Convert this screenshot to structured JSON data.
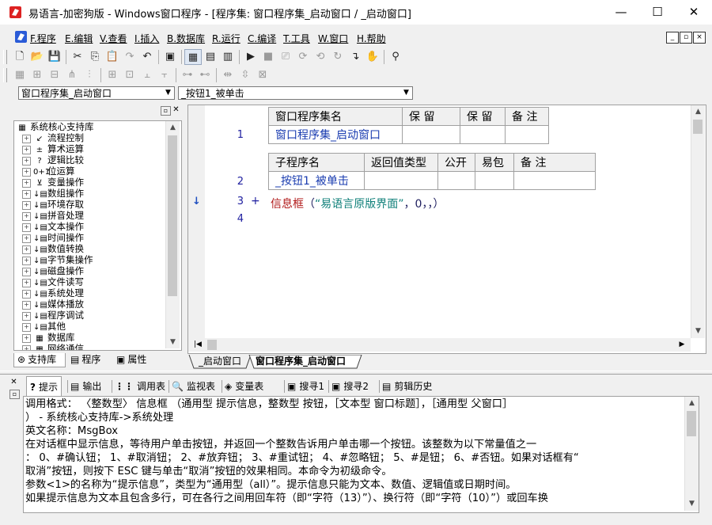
{
  "window": {
    "title": "易语言-加密狗版 - Windows窗口程序 - [程序集: 窗口程序集_启动窗口 / _启动窗口]",
    "minimize": "—",
    "maximize": "☐",
    "close": "✕"
  },
  "menu": {
    "items": [
      "F.程序",
      "E.编辑",
      "V.查看",
      "I.插入",
      "B.数据库",
      "R.运行",
      "C.编译",
      "T.工具",
      "W.窗口",
      "H.帮助"
    ],
    "mdi": [
      "_",
      "▫",
      "×"
    ]
  },
  "toolbar1": {
    "items": [
      {
        "name": "new-icon",
        "glyph": "🗋",
        "enabled": true
      },
      {
        "name": "open-icon",
        "glyph": "📂",
        "enabled": true
      },
      {
        "name": "save-icon",
        "glyph": "💾",
        "enabled": true
      },
      {
        "name": "sep",
        "glyph": "",
        "enabled": false
      },
      {
        "name": "cut-icon",
        "glyph": "✂",
        "enabled": true
      },
      {
        "name": "copy-icon",
        "glyph": "⎘",
        "enabled": true
      },
      {
        "name": "paste-icon",
        "glyph": "📋",
        "enabled": true
      },
      {
        "name": "redo-icon",
        "glyph": "↷",
        "enabled": false
      },
      {
        "name": "undo-icon",
        "glyph": "↶",
        "enabled": true
      },
      {
        "name": "sep",
        "glyph": "",
        "enabled": false
      },
      {
        "name": "find-icon",
        "glyph": "▣",
        "enabled": true
      },
      {
        "name": "sep",
        "glyph": "",
        "enabled": false
      },
      {
        "name": "layout-1-icon",
        "glyph": "▦",
        "enabled": true,
        "selected": true
      },
      {
        "name": "layout-2-icon",
        "glyph": "▤",
        "enabled": true
      },
      {
        "name": "layout-3-icon",
        "glyph": "▥",
        "enabled": true
      },
      {
        "name": "sep",
        "glyph": "",
        "enabled": false
      },
      {
        "name": "run-icon",
        "glyph": "▶",
        "enabled": true
      },
      {
        "name": "stop-icon",
        "glyph": "■",
        "enabled": false
      },
      {
        "name": "step-1-icon",
        "glyph": "⎚",
        "enabled": false
      },
      {
        "name": "step-2-icon",
        "glyph": "⟳",
        "enabled": false
      },
      {
        "name": "step-3-icon",
        "glyph": "⟲",
        "enabled": false
      },
      {
        "name": "step-4-icon",
        "glyph": "↻",
        "enabled": false
      },
      {
        "name": "step-into-icon",
        "glyph": "↴",
        "enabled": true
      },
      {
        "name": "hand-icon",
        "glyph": "✋",
        "enabled": true
      },
      {
        "name": "sep",
        "glyph": "",
        "enabled": false
      },
      {
        "name": "binoculars-icon",
        "glyph": "⚲",
        "enabled": true
      }
    ]
  },
  "toolbar2": {
    "items": [
      "▦",
      "⊞",
      "⊟",
      "⋔",
      "⫶",
      "⊞",
      "⊡",
      "⫠",
      "⫟",
      "⊶",
      "⊷",
      "⇹",
      "⇳",
      "⊠"
    ]
  },
  "selectors": {
    "class": "窗口程序集_启动窗口",
    "method": "_按钮1_被单击"
  },
  "tree": {
    "items": [
      {
        "label": "系统核心支持库",
        "icon": "▦",
        "root": true
      },
      {
        "label": "流程控制",
        "icon": "↙"
      },
      {
        "label": "算术运算",
        "icon": "±"
      },
      {
        "label": "逻辑比较",
        "icon": "?"
      },
      {
        "label": "位运算",
        "icon": "0+1"
      },
      {
        "label": "变量操作",
        "icon": "⊻"
      },
      {
        "label": "数组操作",
        "icon": "↓▤"
      },
      {
        "label": "环境存取",
        "icon": "↓▤"
      },
      {
        "label": "拼音处理",
        "icon": "↓▤"
      },
      {
        "label": "文本操作",
        "icon": "↓▤"
      },
      {
        "label": "时间操作",
        "icon": "↓▤"
      },
      {
        "label": "数值转换",
        "icon": "↓▤"
      },
      {
        "label": "字节集操作",
        "icon": "↓▤"
      },
      {
        "label": "磁盘操作",
        "icon": "↓▤"
      },
      {
        "label": "文件读写",
        "icon": "↓▤"
      },
      {
        "label": "系统处理",
        "icon": "↓▤"
      },
      {
        "label": "媒体播放",
        "icon": "↓▤"
      },
      {
        "label": "程序调试",
        "icon": "↓▤"
      },
      {
        "label": "其他",
        "icon": "↓▤"
      },
      {
        "label": "数据库",
        "icon": "▦"
      },
      {
        "label": "网络通信",
        "icon": "▦"
      }
    ]
  },
  "leftTabs": [
    {
      "label": "支持库",
      "icon": "⊛"
    },
    {
      "label": "程序",
      "icon": "▤"
    },
    {
      "label": "属性",
      "icon": "▣"
    }
  ],
  "editor": {
    "classTable": {
      "headers": [
        "窗口程序集名",
        "保 留",
        "保 留",
        "备 注"
      ],
      "row": [
        "窗口程序集_启动窗口",
        "",
        "",
        ""
      ]
    },
    "subTable": {
      "headers": [
        "子程序名",
        "返回值类型",
        "公开",
        "易包",
        "备 注"
      ],
      "row": [
        "_按钮1_被单击",
        "",
        "",
        "",
        ""
      ]
    },
    "lines": [
      "1",
      "2",
      "3",
      "4"
    ],
    "expand": "+",
    "code": {
      "func": "信息框",
      "open": "（",
      "str": "“易语言原版界面”",
      "rest": "，0，，）"
    },
    "arrow": "↓"
  },
  "codeTabs": [
    "_启动窗口",
    "窗口程序集_启动窗口"
  ],
  "bottomTabs": [
    {
      "label": "提示",
      "icon": "?"
    },
    {
      "label": "输出",
      "icon": "▤"
    },
    {
      "label": "调用表",
      "icon": "⋮⋮"
    },
    {
      "label": "监视表",
      "icon": "🔍"
    },
    {
      "label": "变量表",
      "icon": "◈"
    },
    {
      "label": "搜寻1",
      "icon": "▣"
    },
    {
      "label": "搜寻2",
      "icon": "▣"
    },
    {
      "label": "剪辑历史",
      "icon": "▤"
    }
  ],
  "help": {
    "lines": [
      "    调用格式：  〈整数型〉 信息框 （通用型 提示信息，整数型 按钮，［文本型 窗口标题］，［通用型 父窗口］",
      "） - 系统核心支持库->系统处理",
      "    英文名称：MsgBox",
      "    在对话框中显示信息，等待用户单击按钮，并返回一个整数告诉用户单击哪一个按钮。该整数为以下常量值之一",
      "：  0、#确认钮；  1、#取消钮；  2、#放弃钮；  3、#重试钮；  4、#忽略钮；  5、#是钮；  6、#否钮。如果对话框有“",
      "取消”按钮，则按下 ESC 键与单击“取消”按钮的效果相同。本命令为初级命令。",
      "    参数<1>的名称为“提示信息”，类型为“通用型（all）”。提示信息只能为文本、数值、逻辑值或日期时间。",
      "如果提示信息为文本且包含多行，可在各行之间用回车符（即“字符（13）”）、换行符（即“字符（10）”）或回车换"
    ]
  }
}
